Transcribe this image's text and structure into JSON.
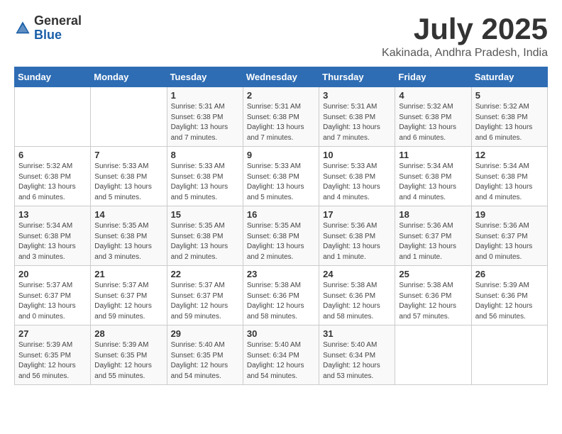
{
  "header": {
    "logo": {
      "general": "General",
      "blue": "Blue"
    },
    "title": "July 2025",
    "location": "Kakinada, Andhra Pradesh, India"
  },
  "weekdays": [
    "Sunday",
    "Monday",
    "Tuesday",
    "Wednesday",
    "Thursday",
    "Friday",
    "Saturday"
  ],
  "weeks": [
    [
      {
        "day": "",
        "detail": ""
      },
      {
        "day": "",
        "detail": ""
      },
      {
        "day": "1",
        "detail": "Sunrise: 5:31 AM\nSunset: 6:38 PM\nDaylight: 13 hours\nand 7 minutes."
      },
      {
        "day": "2",
        "detail": "Sunrise: 5:31 AM\nSunset: 6:38 PM\nDaylight: 13 hours\nand 7 minutes."
      },
      {
        "day": "3",
        "detail": "Sunrise: 5:31 AM\nSunset: 6:38 PM\nDaylight: 13 hours\nand 7 minutes."
      },
      {
        "day": "4",
        "detail": "Sunrise: 5:32 AM\nSunset: 6:38 PM\nDaylight: 13 hours\nand 6 minutes."
      },
      {
        "day": "5",
        "detail": "Sunrise: 5:32 AM\nSunset: 6:38 PM\nDaylight: 13 hours\nand 6 minutes."
      }
    ],
    [
      {
        "day": "6",
        "detail": "Sunrise: 5:32 AM\nSunset: 6:38 PM\nDaylight: 13 hours\nand 6 minutes."
      },
      {
        "day": "7",
        "detail": "Sunrise: 5:33 AM\nSunset: 6:38 PM\nDaylight: 13 hours\nand 5 minutes."
      },
      {
        "day": "8",
        "detail": "Sunrise: 5:33 AM\nSunset: 6:38 PM\nDaylight: 13 hours\nand 5 minutes."
      },
      {
        "day": "9",
        "detail": "Sunrise: 5:33 AM\nSunset: 6:38 PM\nDaylight: 13 hours\nand 5 minutes."
      },
      {
        "day": "10",
        "detail": "Sunrise: 5:33 AM\nSunset: 6:38 PM\nDaylight: 13 hours\nand 4 minutes."
      },
      {
        "day": "11",
        "detail": "Sunrise: 5:34 AM\nSunset: 6:38 PM\nDaylight: 13 hours\nand 4 minutes."
      },
      {
        "day": "12",
        "detail": "Sunrise: 5:34 AM\nSunset: 6:38 PM\nDaylight: 13 hours\nand 4 minutes."
      }
    ],
    [
      {
        "day": "13",
        "detail": "Sunrise: 5:34 AM\nSunset: 6:38 PM\nDaylight: 13 hours\nand 3 minutes."
      },
      {
        "day": "14",
        "detail": "Sunrise: 5:35 AM\nSunset: 6:38 PM\nDaylight: 13 hours\nand 3 minutes."
      },
      {
        "day": "15",
        "detail": "Sunrise: 5:35 AM\nSunset: 6:38 PM\nDaylight: 13 hours\nand 2 minutes."
      },
      {
        "day": "16",
        "detail": "Sunrise: 5:35 AM\nSunset: 6:38 PM\nDaylight: 13 hours\nand 2 minutes."
      },
      {
        "day": "17",
        "detail": "Sunrise: 5:36 AM\nSunset: 6:38 PM\nDaylight: 13 hours\nand 1 minute."
      },
      {
        "day": "18",
        "detail": "Sunrise: 5:36 AM\nSunset: 6:37 PM\nDaylight: 13 hours\nand 1 minute."
      },
      {
        "day": "19",
        "detail": "Sunrise: 5:36 AM\nSunset: 6:37 PM\nDaylight: 13 hours\nand 0 minutes."
      }
    ],
    [
      {
        "day": "20",
        "detail": "Sunrise: 5:37 AM\nSunset: 6:37 PM\nDaylight: 13 hours\nand 0 minutes."
      },
      {
        "day": "21",
        "detail": "Sunrise: 5:37 AM\nSunset: 6:37 PM\nDaylight: 12 hours\nand 59 minutes."
      },
      {
        "day": "22",
        "detail": "Sunrise: 5:37 AM\nSunset: 6:37 PM\nDaylight: 12 hours\nand 59 minutes."
      },
      {
        "day": "23",
        "detail": "Sunrise: 5:38 AM\nSunset: 6:36 PM\nDaylight: 12 hours\nand 58 minutes."
      },
      {
        "day": "24",
        "detail": "Sunrise: 5:38 AM\nSunset: 6:36 PM\nDaylight: 12 hours\nand 58 minutes."
      },
      {
        "day": "25",
        "detail": "Sunrise: 5:38 AM\nSunset: 6:36 PM\nDaylight: 12 hours\nand 57 minutes."
      },
      {
        "day": "26",
        "detail": "Sunrise: 5:39 AM\nSunset: 6:36 PM\nDaylight: 12 hours\nand 56 minutes."
      }
    ],
    [
      {
        "day": "27",
        "detail": "Sunrise: 5:39 AM\nSunset: 6:35 PM\nDaylight: 12 hours\nand 56 minutes."
      },
      {
        "day": "28",
        "detail": "Sunrise: 5:39 AM\nSunset: 6:35 PM\nDaylight: 12 hours\nand 55 minutes."
      },
      {
        "day": "29",
        "detail": "Sunrise: 5:40 AM\nSunset: 6:35 PM\nDaylight: 12 hours\nand 54 minutes."
      },
      {
        "day": "30",
        "detail": "Sunrise: 5:40 AM\nSunset: 6:34 PM\nDaylight: 12 hours\nand 54 minutes."
      },
      {
        "day": "31",
        "detail": "Sunrise: 5:40 AM\nSunset: 6:34 PM\nDaylight: 12 hours\nand 53 minutes."
      },
      {
        "day": "",
        "detail": ""
      },
      {
        "day": "",
        "detail": ""
      }
    ]
  ]
}
